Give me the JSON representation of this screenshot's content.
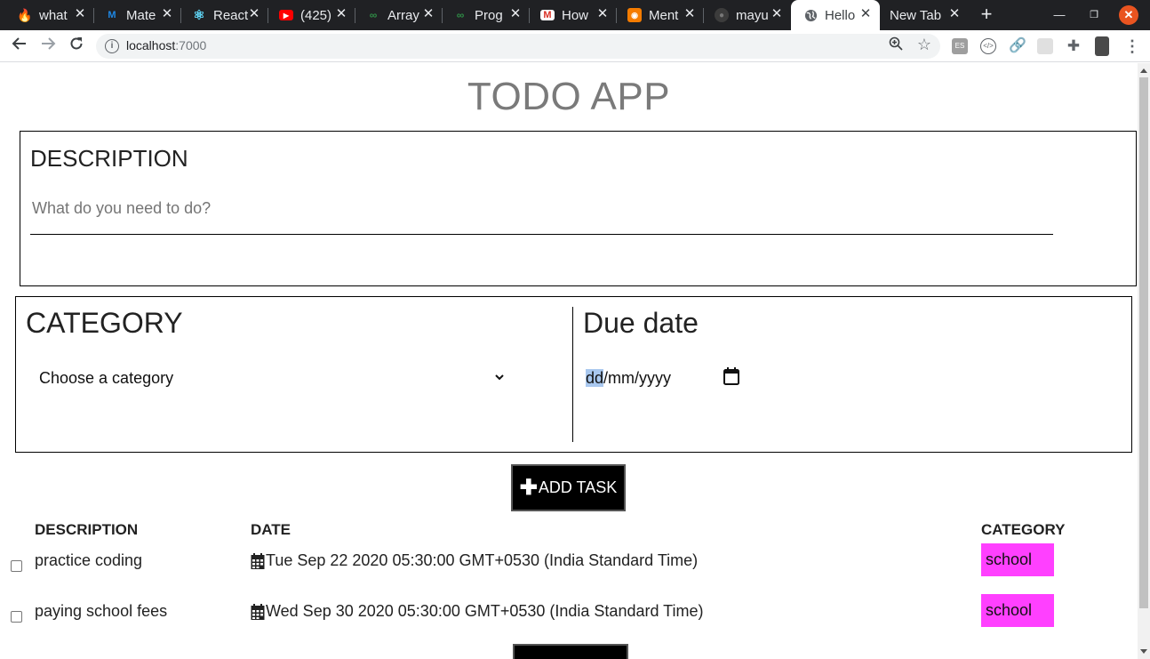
{
  "browser": {
    "tabs": [
      {
        "title": "what",
        "favicon": "flame-icon",
        "color": "#f5a623"
      },
      {
        "title": "Mate",
        "favicon": "mui-icon",
        "color": "#1e88e5"
      },
      {
        "title": "React",
        "favicon": "react-icon",
        "color": "#61dafb"
      },
      {
        "title": "(425)",
        "favicon": "youtube-icon",
        "color": "#ff0000"
      },
      {
        "title": "Array",
        "favicon": "gfg-icon",
        "color": "#2f8d46"
      },
      {
        "title": "Prog",
        "favicon": "gfg-icon",
        "color": "#2f8d46"
      },
      {
        "title": "How",
        "favicon": "gmail-icon",
        "color": "#d93025"
      },
      {
        "title": "Ment",
        "favicon": "robot-icon",
        "color": "#f57c00"
      },
      {
        "title": "mayu",
        "favicon": "github-icon",
        "color": "#24292e"
      },
      {
        "title": "Hello",
        "favicon": "globe-icon",
        "color": "#5f6368"
      },
      {
        "title": "New Tab",
        "favicon": "",
        "color": ""
      }
    ],
    "url_host": "localhost",
    "url_port": ":7000"
  },
  "app": {
    "title": "TODO APP",
    "description_label": "DESCRIPTION",
    "description_placeholder": "What do you need to do?",
    "category_label": "CATEGORY",
    "category_selected": "Choose a category",
    "due_label": "Due date",
    "date_dd": "dd",
    "date_rest": "/mm/yyyy",
    "add_button": "ADD TASK",
    "table": {
      "headers": [
        "DESCRIPTION",
        "DATE",
        "CATEGORY"
      ],
      "rows": [
        {
          "description": "practice coding",
          "date": "Tue Sep 22 2020 05:30:00 GMT+0530 (India Standard Time)",
          "category": "school"
        },
        {
          "description": "paying school fees",
          "date": "Wed Sep 30 2020 05:30:00 GMT+0530 (India Standard Time)",
          "category": "school"
        }
      ]
    }
  },
  "colors": {
    "category_badge": "#ff40ff",
    "button_bg": "#000000"
  }
}
